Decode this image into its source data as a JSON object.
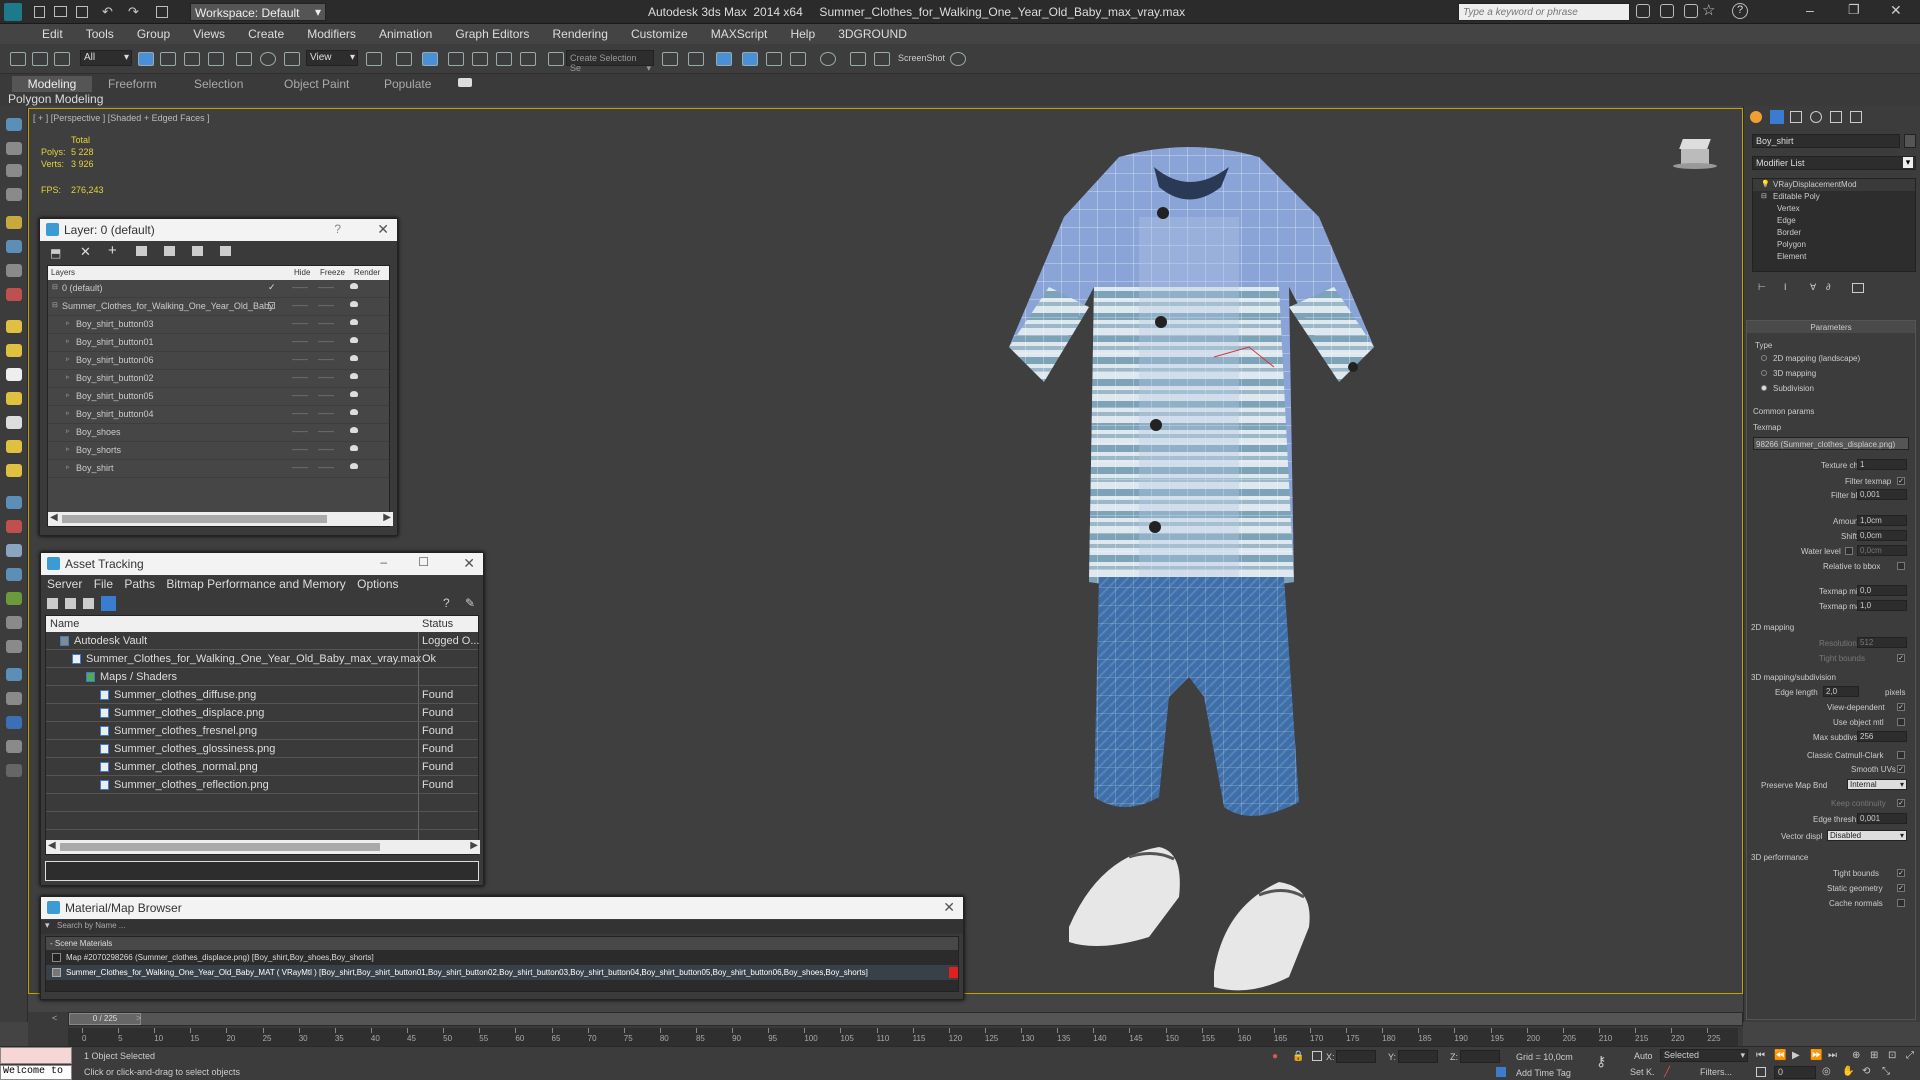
{
  "app": {
    "workspace_label": "Workspace: Default",
    "title": "Autodesk 3ds Max  2014 x64     Summer_Clothes_for_Walking_One_Year_Old_Baby_max_vray.max",
    "search_placeholder": "Type a keyword or phrase"
  },
  "menu": [
    "Edit",
    "Tools",
    "Group",
    "Views",
    "Create",
    "Modifiers",
    "Animation",
    "Graph Editors",
    "Rendering",
    "Customize",
    "MAXScript",
    "Help",
    "3DGROUND"
  ],
  "toolbar": {
    "filter_all": "All",
    "view_label": "View",
    "selection_set": "Create Selection Se",
    "screenshot": "ScreenShot"
  },
  "ribbon": {
    "tabs": [
      "Modeling",
      "Freeform",
      "Selection",
      "Object Paint",
      "Populate"
    ],
    "sub": "Polygon Modeling"
  },
  "viewport": {
    "label": "[ + ] [Perspective ] [Shaded + Edged Faces ]",
    "total": "Total",
    "polys_label": "Polys:",
    "polys_value": "5 228",
    "verts_label": "Verts:",
    "verts_value": "3 926",
    "fps_label": "FPS:",
    "fps_value": "276,243"
  },
  "layer_panel": {
    "title": "Layer: 0 (default)",
    "help": "?",
    "col_layers": "Layers",
    "col_hide": "Hide",
    "col_freeze": "Freeze",
    "col_render": "Render",
    "rows": [
      "0 (default)",
      "Summer_Clothes_for_Walking_One_Year_Old_Baby",
      "Boy_shirt_button03",
      "Boy_shirt_button01",
      "Boy_shirt_button06",
      "Boy_shirt_button02",
      "Boy_shirt_button05",
      "Boy_shirt_button04",
      "Boy_shoes",
      "Boy_shorts",
      "Boy_shirt"
    ],
    "dash": "——"
  },
  "asset_panel": {
    "title": "Asset Tracking",
    "menu": [
      "Server",
      "File",
      "Paths",
      "Bitmap Performance and Memory",
      "Options"
    ],
    "col_name": "Name",
    "col_status": "Status",
    "rows": [
      {
        "name": "Autodesk Vault",
        "status": "Logged O..."
      },
      {
        "name": "Summer_Clothes_for_Walking_One_Year_Old_Baby_max_vray.max",
        "status": "Ok"
      },
      {
        "name": "Maps / Shaders",
        "status": ""
      },
      {
        "name": "Summer_clothes_diffuse.png",
        "status": "Found"
      },
      {
        "name": "Summer_clothes_displace.png",
        "status": "Found"
      },
      {
        "name": "Summer_clothes_fresnel.png",
        "status": "Found"
      },
      {
        "name": "Summer_clothes_glossiness.png",
        "status": "Found"
      },
      {
        "name": "Summer_clothes_normal.png",
        "status": "Found"
      },
      {
        "name": "Summer_clothes_reflection.png",
        "status": "Found"
      }
    ]
  },
  "material_panel": {
    "title": "Material/Map Browser",
    "search_placeholder": "Search by Name ...",
    "section": "- Scene Materials",
    "row1": "Map #2070298266 (Summer_clothes_displace.png) [Boy_shirt,Boy_shoes,Boy_shorts]",
    "row2": "Summer_Clothes_for_Walking_One_Year_Old_Baby_MAT ( VRayMtl ) [Boy_shirt,Boy_shirt_button01,Boy_shirt_button02,Boy_shirt_button03,Boy_shirt_button04,Boy_shirt_button05,Boy_shirt_button06,Boy_shoes,Boy_shorts]"
  },
  "command_panel": {
    "object_name": "Boy_shirt",
    "modifier_list": "Modifier List",
    "stack": [
      "VRayDisplacementMod",
      "Editable Poly",
      "Vertex",
      "Edge",
      "Border",
      "Polygon",
      "Element"
    ],
    "parameters": "Parameters",
    "type_label": "Type",
    "type_options": [
      "2D mapping (landscape)",
      "3D mapping",
      "Subdivision"
    ],
    "common": "Common params",
    "texmap": "Texmap",
    "texmap_value": "98266 (Summer_clothes_displace.png)",
    "texture_chan": "Texture chan",
    "texture_chan_value": "1",
    "filter_texmap": "Filter texmap",
    "filter_blur": "Filter blur",
    "filter_blur_value": "0,001",
    "amount": "Amount",
    "amount_value": "1,0cm",
    "shift": "Shift",
    "shift_value": "0,0cm",
    "water_level": "Water level",
    "water_level_value": "0,0cm",
    "relative_bbox": "Relative to bbox",
    "texmap_min": "Texmap min",
    "texmap_min_value": "0,0",
    "texmap_max": "Texmap max",
    "texmap_max_value": "1,0",
    "mapping2d": "2D mapping",
    "resolution": "Resolution",
    "resolution_value": "512",
    "tight_bounds": "Tight bounds",
    "mapping3d": "3D mapping/subdivision",
    "edge_length": "Edge length",
    "edge_length_value": "2,0",
    "pixels": "pixels",
    "view_dependent": "View-dependent",
    "use_object_mtl": "Use object mtl",
    "max_subdivs": "Max subdivs",
    "max_subdivs_value": "256",
    "catmull": "Classic Catmull-Clark",
    "smooth_uvs": "Smooth UVs",
    "preserve": "Preserve Map Bnd",
    "preserve_value": "Internal",
    "keep_continuity": "Keep continuity",
    "edge_thresh": "Edge thresh",
    "edge_thresh_value": "0,001",
    "vector_displ": "Vector displ",
    "vector_displ_value": "Disabled",
    "perf": "3D performance",
    "tight_bounds2": "Tight bounds",
    "static_geometry": "Static geometry",
    "cache_normals": "Cache normals"
  },
  "timeline": {
    "frame": "0 / 225",
    "ticks": [
      "0",
      "5",
      "10",
      "15",
      "20",
      "25",
      "30",
      "35",
      "40",
      "45",
      "50",
      "55",
      "60",
      "65",
      "70",
      "75",
      "80",
      "85",
      "90",
      "95",
      "100",
      "105",
      "110",
      "115",
      "120",
      "125",
      "130",
      "135",
      "140",
      "145",
      "150",
      "155",
      "160",
      "165",
      "170",
      "175",
      "180",
      "185",
      "190",
      "195",
      "200",
      "205",
      "210",
      "215",
      "220",
      "225"
    ]
  },
  "status": {
    "maxscript": "Welcome to",
    "selected": "1 Object Selected",
    "hint": "Click or click-and-drag to select objects",
    "x": "X:",
    "y": "Y:",
    "z": "Z:",
    "grid": "Grid = 10,0cm",
    "add_time_tag": "Add Time Tag",
    "auto": "Auto",
    "setk": "Set K.",
    "selected_dd": "Selected",
    "filters": "Filters...",
    "frame_field": "0"
  }
}
